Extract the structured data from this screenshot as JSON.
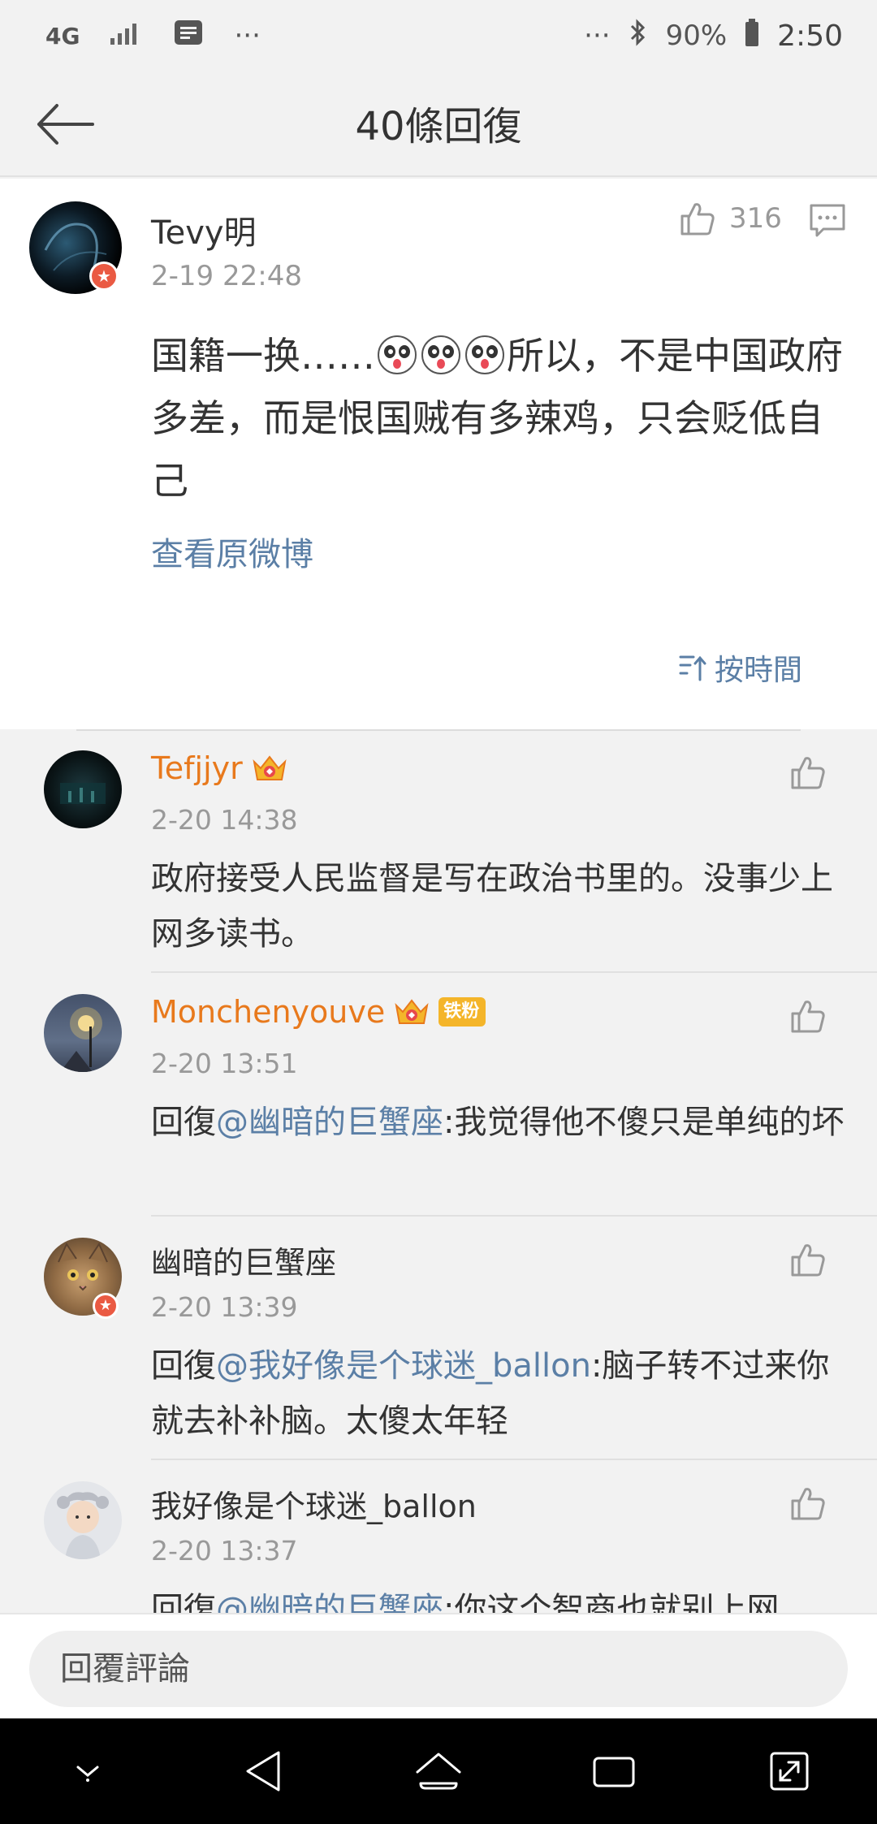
{
  "status_bar": {
    "network": "4G",
    "dots_left": "···",
    "dots_right": "···",
    "battery": "90%",
    "time": "2:50"
  },
  "header": {
    "title": "40條回復",
    "back_icon": "back-arrow-icon"
  },
  "main_post": {
    "username": "Tevy明",
    "time": "2-19 22:48",
    "likes": "316",
    "text_part1": "国籍一换……",
    "text_part2": "所以，不是中国政府多差，而是恨国贼有多辣鸡，只会贬低自己",
    "emoji_icon": "panda-emoji-icon",
    "view_original": "查看原微博",
    "sort_label": "按時間"
  },
  "replies": [
    {
      "username": "Tefjjyr",
      "time": "2-20 14:38",
      "text": "政府接受人民监督是写在政治书里的。没事少上网多读书。",
      "vip": true
    },
    {
      "username": "Monchenyouve",
      "time": "2-20 13:51",
      "reply_prefix": "回復",
      "mention": "@幽暗的巨蟹座",
      "text": ":我觉得他不傻只是单纯的坏",
      "vip": true,
      "fan_badge": "铁粉"
    },
    {
      "username": "幽暗的巨蟹座",
      "time": "2-20 13:39",
      "reply_prefix": "回復",
      "mention": "@我好像是个球迷_ballon",
      "text": ":脑子转不过来你就去补补脑。太傻太年轻"
    },
    {
      "username": "我好像是个球迷_ballon",
      "time": "2-20 13:37",
      "reply_prefix": "回復",
      "mention": "@幽暗的巨蟹座",
      "text": ":你这个智商也就别上网"
    }
  ],
  "input_bar": {
    "placeholder": "回覆評論"
  },
  "colors": {
    "link": "#5b7fa6",
    "vip_name": "#e8791c",
    "badge_red": "#ea5a43",
    "background": "#f2f2f2"
  }
}
